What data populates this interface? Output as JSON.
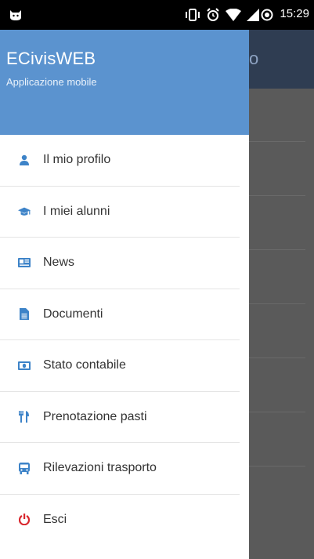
{
  "status_bar": {
    "time": "15:29"
  },
  "drawer": {
    "title": "ECivisWEB",
    "subtitle": "Applicazione mobile",
    "items": [
      {
        "label": "Il mio profilo",
        "icon": "user-icon",
        "color": "#3d83c8"
      },
      {
        "label": "I miei alunni",
        "icon": "graduation-cap-icon",
        "color": "#3d83c8"
      },
      {
        "label": "News",
        "icon": "newspaper-icon",
        "color": "#3d83c8"
      },
      {
        "label": "Documenti",
        "icon": "document-icon",
        "color": "#3d83c8"
      },
      {
        "label": "Stato contabile",
        "icon": "money-icon",
        "color": "#3d83c8"
      },
      {
        "label": "Prenotazione pasti",
        "icon": "cutlery-icon",
        "color": "#3d83c8"
      },
      {
        "label": "Rilevazioni trasporto",
        "icon": "bus-icon",
        "color": "#3d83c8"
      },
      {
        "label": "Esci",
        "icon": "power-icon",
        "color": "#d9272e"
      }
    ]
  },
  "background": {
    "toolbar_fragment": "o"
  },
  "colors": {
    "header": "#5b93cf",
    "accent": "#3d83c8",
    "danger": "#d9272e"
  }
}
